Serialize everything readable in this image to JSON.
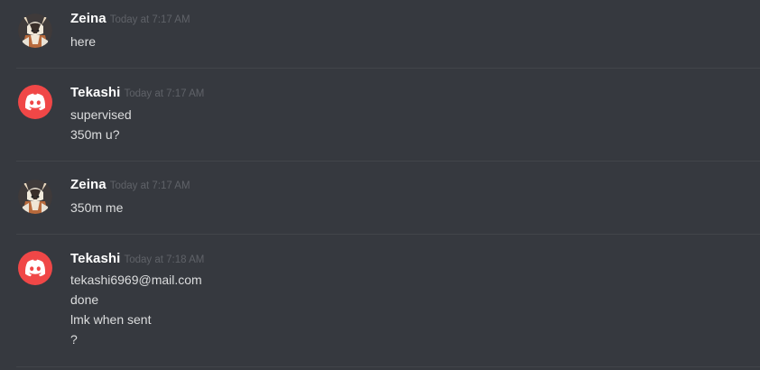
{
  "colors": {
    "background": "#36393f",
    "divider": "#42454a",
    "username": "#ffffff",
    "timestamp": "#5f6268",
    "message_text": "#dcddde",
    "discord_avatar": "#f04747"
  },
  "messages": [
    {
      "author": "Zeina",
      "timestamp": "Today at 7:17 AM",
      "avatar_icon": "anime-character-avatar",
      "lines": [
        "here"
      ]
    },
    {
      "author": "Tekashi",
      "timestamp": "Today at 7:17 AM",
      "avatar_icon": "discord-logo-avatar",
      "lines": [
        "supervised",
        "350m u?"
      ]
    },
    {
      "author": "Zeina",
      "timestamp": "Today at 7:17 AM",
      "avatar_icon": "anime-character-avatar",
      "lines": [
        "350m me"
      ]
    },
    {
      "author": "Tekashi",
      "timestamp": "Today at 7:18 AM",
      "avatar_icon": "discord-logo-avatar",
      "lines": [
        "tekashi6969@mail.com",
        "done",
        "lmk when sent",
        "?"
      ]
    }
  ]
}
